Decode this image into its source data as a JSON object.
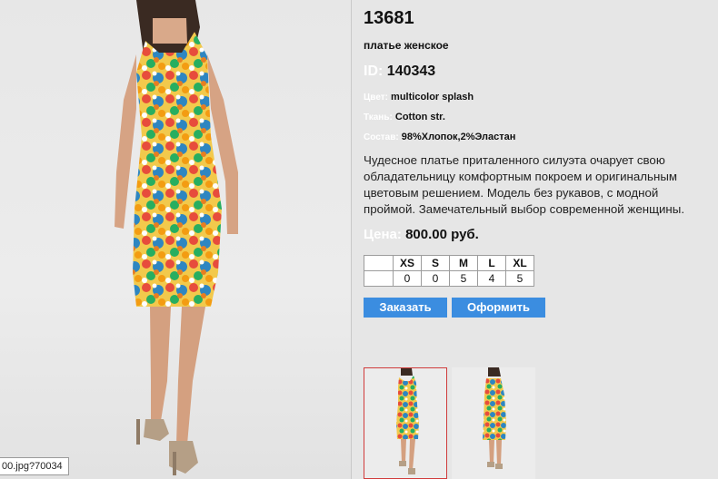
{
  "product": {
    "code": "13681",
    "name": "платье женское",
    "id_label": "ID:",
    "id_value": "140343",
    "attributes": [
      {
        "label": "Цвет:",
        "value": "multicolor splash"
      },
      {
        "label": "Ткань:",
        "value": "Cotton str."
      },
      {
        "label": "Состав:",
        "value": "98%Хлопок,2%Эластан"
      }
    ],
    "description_lines": [
      "Чудесное платье приталенного силуэта очарует свою",
      "обладательницу комфортным покроем и оригинальным",
      "цветовым решением. Модель без рукавов, с  модной",
      "проймой. Замечательный выбор современной женщины."
    ],
    "price_label": "Цена:",
    "price_value": "800.00 руб."
  },
  "sizes": {
    "headers": [
      "XS",
      "S",
      "M",
      "L",
      "XL"
    ],
    "stock": [
      "0",
      "0",
      "5",
      "4",
      "5"
    ]
  },
  "buttons": {
    "order": "Заказать",
    "checkout": "Оформить"
  },
  "photo": {
    "url_tooltip": "00.jpg?70034"
  },
  "thumbnails": [
    {
      "view": "front",
      "selected": true
    },
    {
      "view": "back",
      "selected": false
    }
  ],
  "colors": {
    "button_blue": "#3b8de0",
    "selected_border": "#d03b3b",
    "page_bg": "#e6e6e6"
  }
}
